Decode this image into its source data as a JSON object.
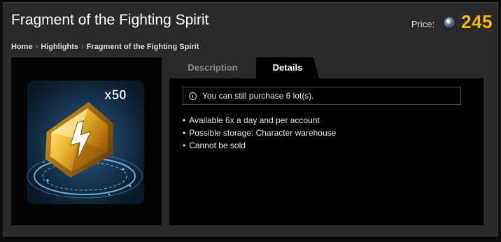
{
  "header": {
    "title": "Fragment of the Fighting Spirit",
    "price_label": "Price:",
    "price_value": "245",
    "currency_icon": "coin-icon"
  },
  "breadcrumb": {
    "items": [
      "Home",
      "Highlights",
      "Fragment of the Fighting Spirit"
    ],
    "separator": "›"
  },
  "product_image": {
    "quantity_label": "x50",
    "icon": "lightning-crystal-icon"
  },
  "tabs": [
    {
      "label": "Description",
      "active": false
    },
    {
      "label": "Details",
      "active": true
    }
  ],
  "details": {
    "notice": "You can still purchase 6 lot(s).",
    "notice_icon": "info-icon",
    "features": [
      "Available 6x a day and per account",
      "Possible storage: Character warehouse",
      "Cannot be sold"
    ]
  },
  "colors": {
    "price": "#f5b800",
    "panel": "#2a2a2a",
    "content_bg": "#000000"
  }
}
